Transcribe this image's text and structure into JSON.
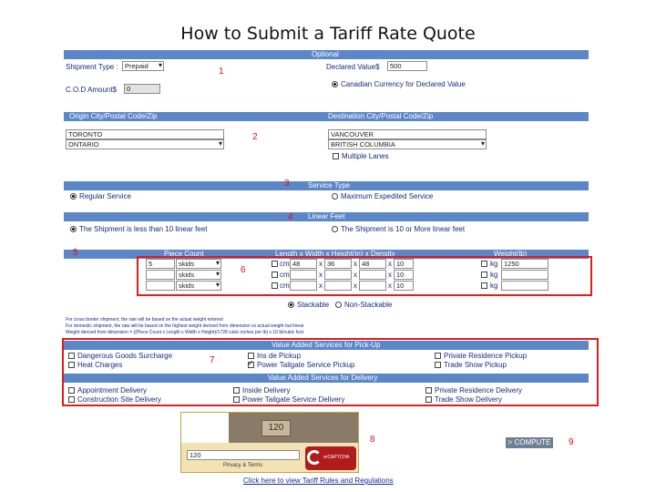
{
  "title": "How to Submit a Tariff Rate Quote",
  "annotations": [
    "1",
    "2",
    "3",
    "4",
    "5",
    "6",
    "7",
    "8",
    "9"
  ],
  "optional": {
    "header": "Optional",
    "shipment_type_label": "Shipment Type :",
    "shipment_type_value": "Prepaid",
    "declared_value_label": "Declared Value$",
    "declared_value": "500",
    "cod_label": "C.O.D Amount$",
    "cod_value": "0",
    "currency_label": "Canadian Currency for Declared Value"
  },
  "locations": {
    "origin_header": "Origin City/Postal Code/Zip",
    "destination_header": "Destination City/Postal Code/Zip",
    "origin_city": "TORONTO",
    "origin_province": "ONTARIO",
    "dest_city": "VANCOUVER",
    "dest_province": "BRITISH COLUMBIA",
    "multiple_lanes": "Multiple Lanes"
  },
  "service": {
    "header": "Service Type",
    "regular": "Regular Service",
    "expedited": "Maximum Expedited Service"
  },
  "linear": {
    "header": "Linear Feet",
    "less": "The Shipment is less than 10 linear feet",
    "more": "The Shipment is 10 or More linear feet"
  },
  "pieces": {
    "piece_count_header": "Piece Count",
    "dims_header": "Length x Width x Height(in) x Density",
    "weight_header": "Weight(lb)",
    "rows": [
      {
        "count": "5",
        "unit": "skids",
        "l": "48",
        "w": "36",
        "h": "48",
        "d": "10",
        "weight": "1250"
      },
      {
        "count": "",
        "unit": "skids",
        "l": "",
        "w": "",
        "h": "",
        "d": "10",
        "weight": ""
      },
      {
        "count": "",
        "unit": "skids",
        "l": "",
        "w": "",
        "h": "",
        "d": "10",
        "weight": ""
      }
    ],
    "cm": "cm",
    "x": "x",
    "kg": "kg",
    "stackable": "Stackable",
    "non_stackable": "Non-Stackable"
  },
  "notes": [
    "For cross border shipment, the rate will be based on the actual weight entered",
    "For domestic shipment, the rate will be based on the highest weight derived from dimension vs actual weight but linear",
    "Weight derived from dimension = ((Piece Count x Length x Width x Height)/1728 cubic inches per lb) x 10 lb/cubic foot"
  ],
  "pickup": {
    "header": "Value Added Services for Pick-Up",
    "items": [
      {
        "label": "Dangerous Goods Surcharge",
        "checked": false
      },
      {
        "label": "Ins de Pickup",
        "checked": false
      },
      {
        "label": "Private Residence Pickup",
        "checked": false
      },
      {
        "label": "Heat Charges",
        "checked": false
      },
      {
        "label": "Power Tailgate Service Pickup",
        "checked": true
      },
      {
        "label": "Trade Show Pickup",
        "checked": false
      }
    ]
  },
  "delivery": {
    "header": "Value Added Services for Delivery",
    "items": [
      {
        "label": "Appointment Delivery"
      },
      {
        "label": "Inside Delivery"
      },
      {
        "label": "Private Residence Delivery"
      },
      {
        "label": "Construction Site Delivery"
      },
      {
        "label": "Power Tailgate Service Delivery"
      },
      {
        "label": "Trade Show Delivery"
      }
    ]
  },
  "captcha": {
    "code": "120",
    "input": "120",
    "links": "Privacy & Terms",
    "brand": "reCAPTCHA"
  },
  "compute_button": "> COMPUTE",
  "tariff_link": "Click here to view Tariff Rules and Regulations",
  "colors": {
    "header_bar": "#5b86c8",
    "annotation": "#e01c1c",
    "text": "#1a2a7a"
  }
}
